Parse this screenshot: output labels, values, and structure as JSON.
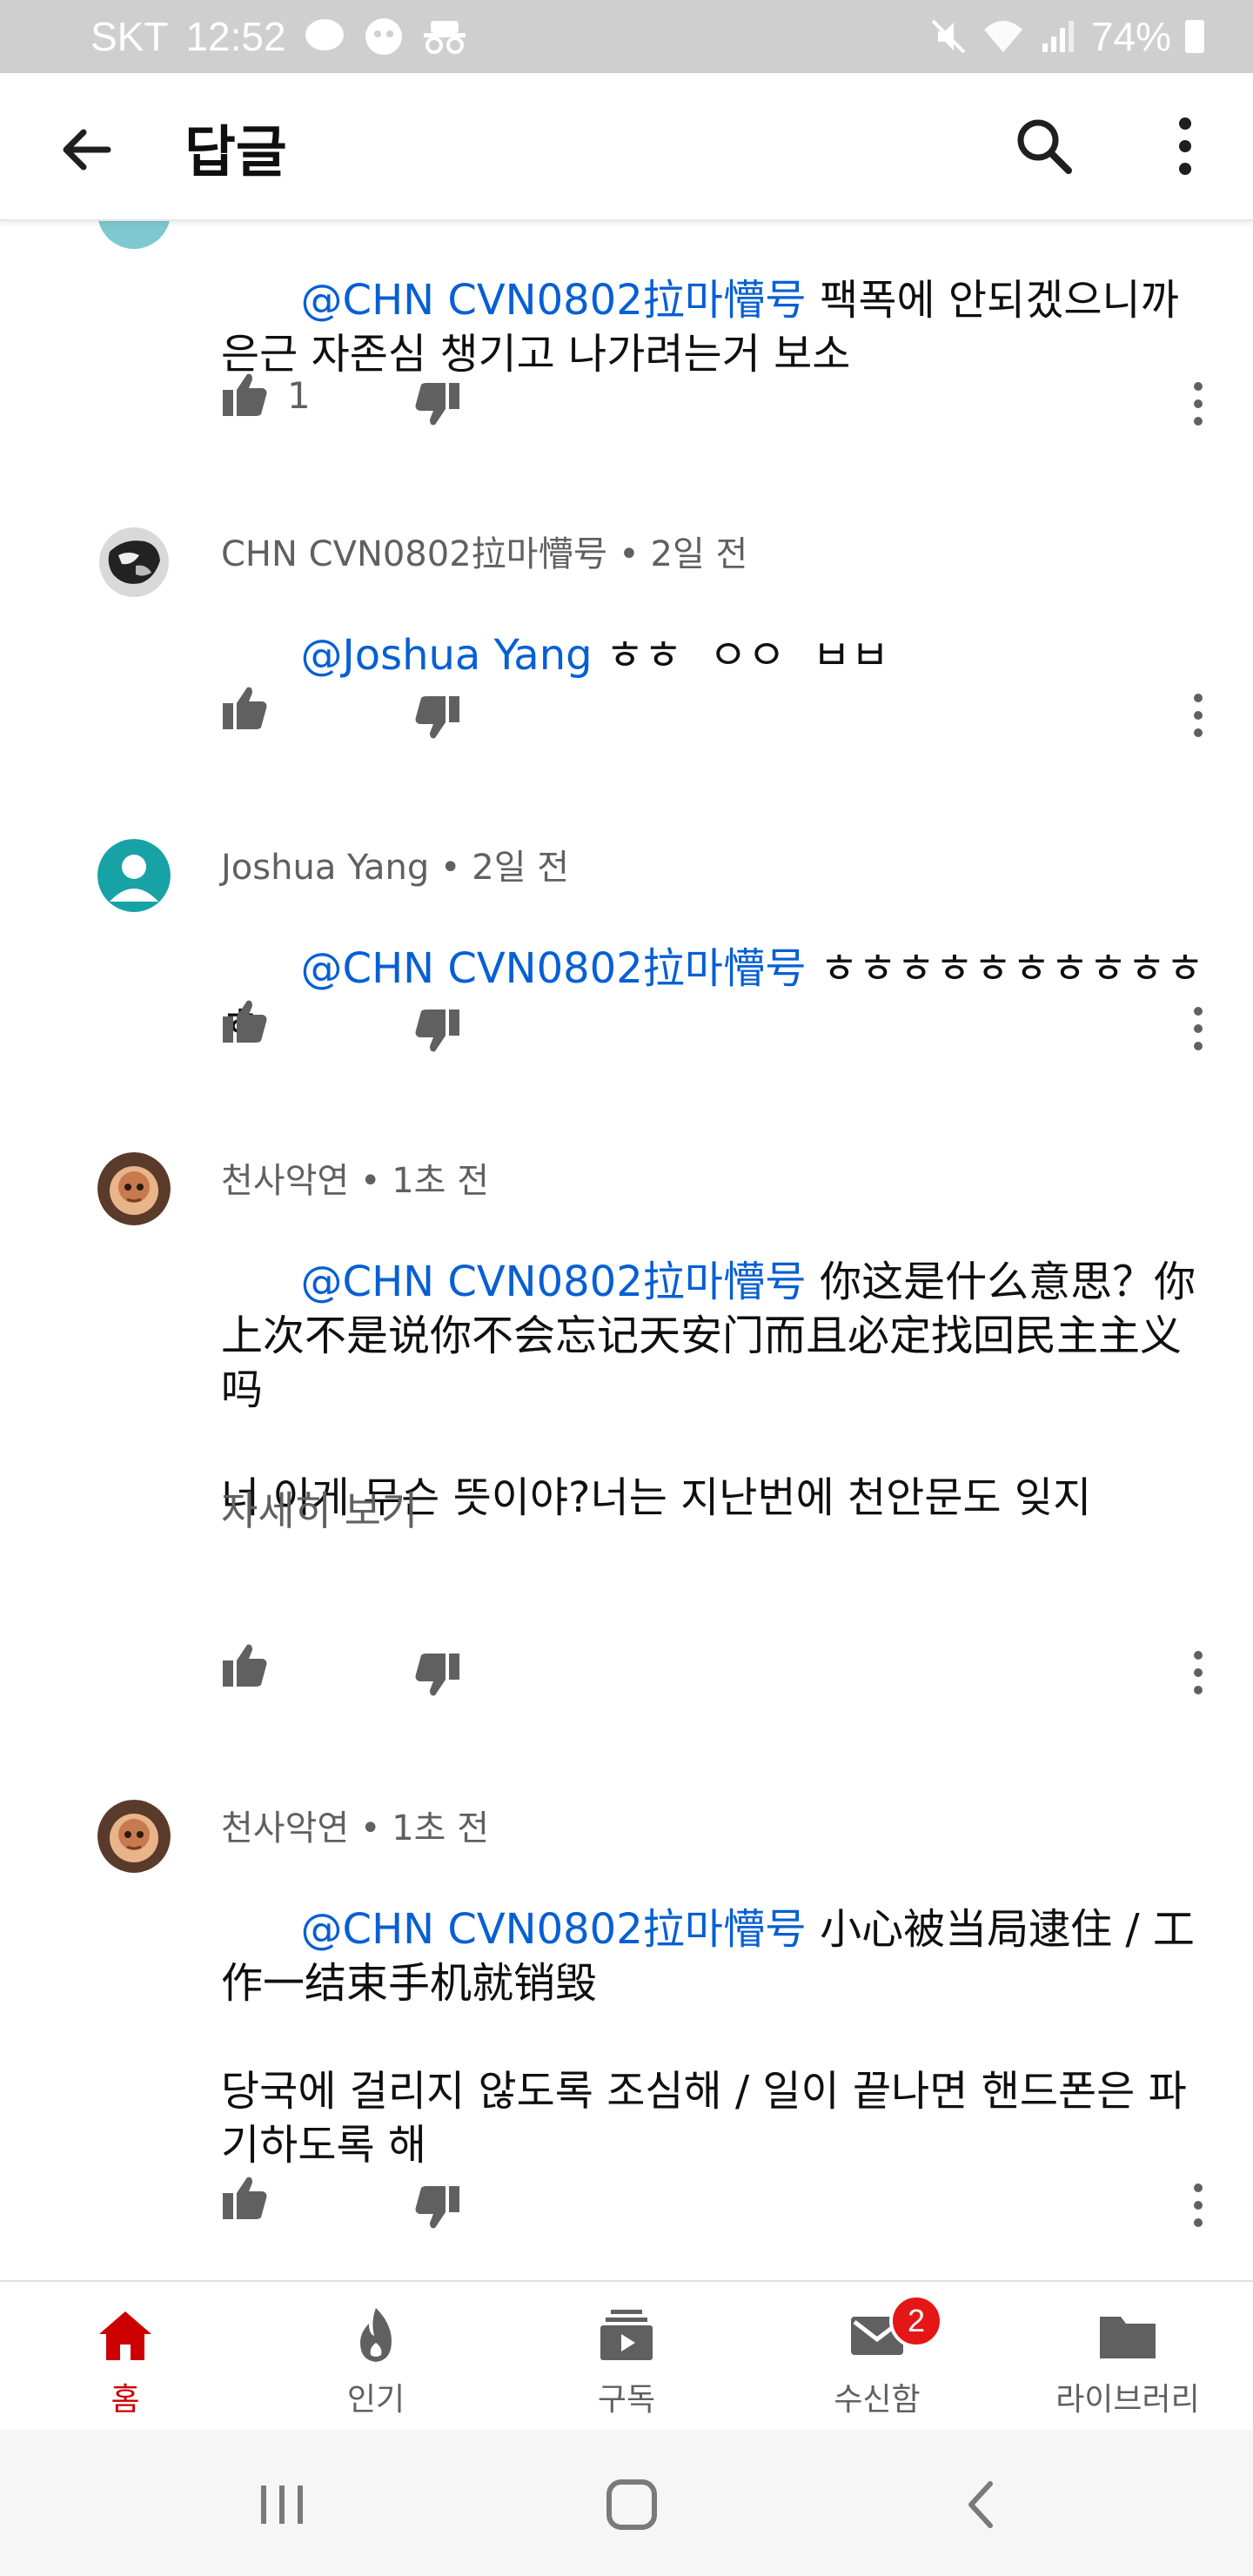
{
  "status_bar": {
    "carrier": "SKT",
    "time": "12:52",
    "battery": "74%"
  },
  "appbar": {
    "title": "답글"
  },
  "comments": [
    {
      "author": "",
      "time": "",
      "mention": "@CHN CVN0802拉마懵号",
      "text": " 팩폭에 안되겠으니까 은근 자존심 챙기고 나가려는거 보소",
      "likes": "1"
    },
    {
      "author": "CHN CVN0802拉마懵号",
      "time": "2일 전",
      "mention": "@Joshua Yang",
      "text": " ㅎㅎ  ㅇㅇ  ㅂㅂ",
      "likes": ""
    },
    {
      "author": "Joshua Yang",
      "time": "2일 전",
      "mention": "@CHN CVN0802拉마懵号",
      "text": " ㅎㅎㅎㅎㅎㅎㅎㅎㅎㅎㅎ",
      "likes": ""
    },
    {
      "author": "천사악연",
      "time": "1초 전",
      "mention": "@CHN CVN0802拉마懵号",
      "text": " 你这是什么意思？你上次不是说你不会忘记天安门而且必定找回民主主义吗\n\n너 이게 무슨 뜻이야?너는 지난번에 천안문도 잊지",
      "more": "자세히 보기",
      "likes": ""
    },
    {
      "author": "천사악연",
      "time": "1초 전",
      "mention": "@CHN CVN0802拉마懵号",
      "text": " 小心被当局逮住 / 工作一结束手机就销毁\n\n당국에 걸리지 않도록 조심해 / 일이 끝나면 핸드폰은 파기하도록 해",
      "likes": ""
    }
  ],
  "bottom_nav": {
    "items": [
      {
        "label": "홈",
        "icon": "home-icon",
        "active": true
      },
      {
        "label": "인기",
        "icon": "trending-icon"
      },
      {
        "label": "구독",
        "icon": "subscriptions-icon"
      },
      {
        "label": "수신함",
        "icon": "inbox-icon",
        "badge": "2"
      },
      {
        "label": "라이브러리",
        "icon": "library-icon"
      }
    ]
  },
  "colors": {
    "mention": "#065fd4",
    "active_nav": "#cc0000",
    "badge": "#e41616",
    "avatar_teal": "#17a2a5"
  }
}
